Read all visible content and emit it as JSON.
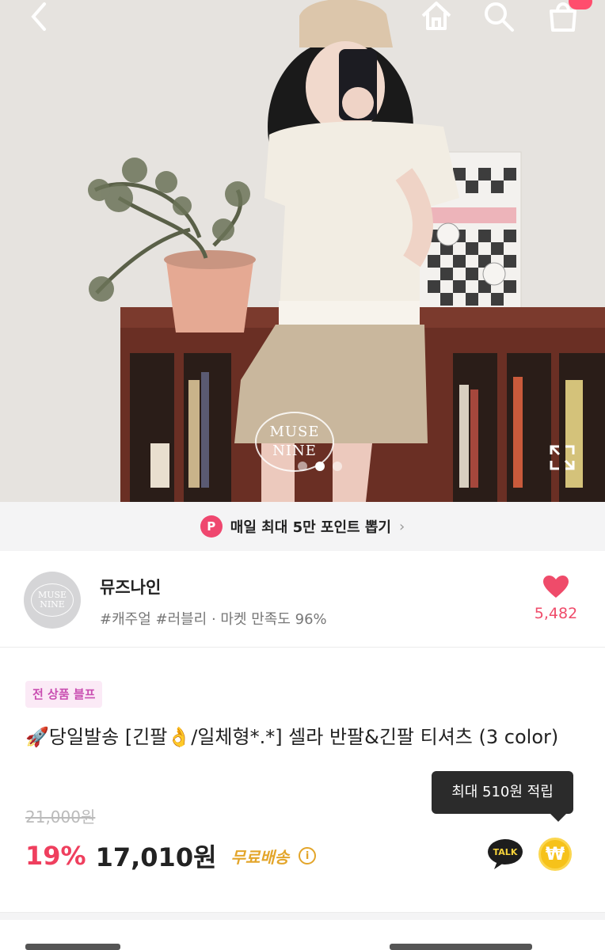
{
  "header": {
    "icons": [
      "back-icon",
      "home-icon",
      "search-icon",
      "shopping-bag-icon"
    ],
    "cart_badge": ""
  },
  "hero": {
    "watermark_line1": "MUSE",
    "watermark_line2": "NINE",
    "slide_count": 3,
    "active_slide": 2
  },
  "point_banner": {
    "badge": "P",
    "text": "매일 최대 5만 포인트 뽑기",
    "chevron": "›"
  },
  "shop": {
    "avatar_line1": "MUSE",
    "avatar_line2": "NINE",
    "name": "뮤즈나인",
    "meta": "#캐주얼 #러블리 · 마켓 만족도 96%",
    "likes": "5,482"
  },
  "product": {
    "tag": "전 상품 블프",
    "title": "🚀당일발송 [긴팔👌/일체형*.*] 셀라 반팔&긴팔 티셔츠 (3 color)",
    "original_price": "21,000원",
    "discount": "19%",
    "price": "17,010원",
    "shipping": "무료배송",
    "info_symbol": "i",
    "tooltip": "최대 510원 적립",
    "talk_label": "TALK",
    "won_symbol": "₩"
  },
  "colors": {
    "accent_pink": "#ef3f5e",
    "heart": "#ef4b6a",
    "shipping_gold": "#e3a52a",
    "tag_bg": "#fbeaf6",
    "tag_text": "#c94eb1"
  }
}
